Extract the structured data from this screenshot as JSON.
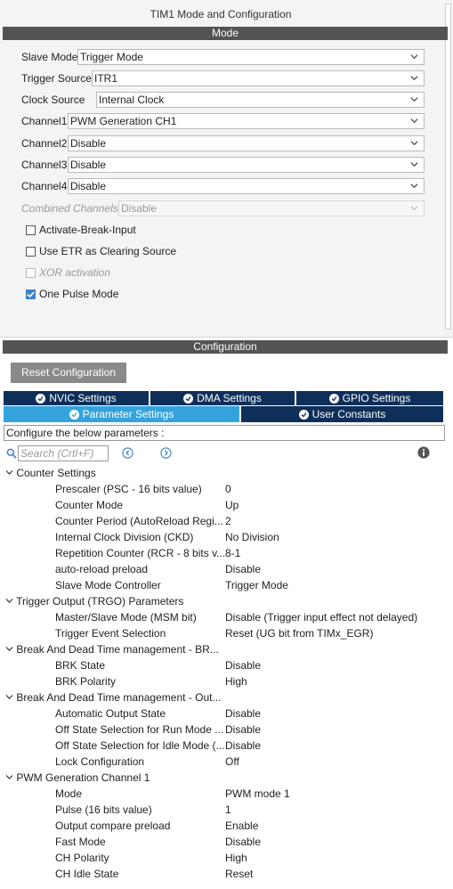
{
  "title": "TIM1 Mode and Configuration",
  "mode_section": "Mode",
  "fields": [
    {
      "label": "Slave Mode",
      "value": "Trigger Mode",
      "disabled": false
    },
    {
      "label": "Trigger Source",
      "value": "ITR1",
      "disabled": false
    },
    {
      "label": "Clock Source",
      "value": "Internal Clock",
      "disabled": false
    },
    {
      "label": "Channel1",
      "value": "PWM Generation CH1",
      "disabled": false
    },
    {
      "label": "Channel2",
      "value": "Disable",
      "disabled": false
    },
    {
      "label": "Channel3",
      "value": "Disable",
      "disabled": false
    },
    {
      "label": "Channel4",
      "value": "Disable",
      "disabled": false
    },
    {
      "label": "Combined Channels",
      "value": "Disable",
      "disabled": true
    }
  ],
  "checkboxes": [
    {
      "label": "Activate-Break-Input",
      "checked": false,
      "disabled": false
    },
    {
      "label": "Use ETR as Clearing Source",
      "checked": false,
      "disabled": false
    },
    {
      "label": "XOR activation",
      "checked": false,
      "disabled": true
    },
    {
      "label": "One Pulse Mode",
      "checked": true,
      "disabled": false
    }
  ],
  "config_section": "Configuration",
  "reset_button": "Reset Configuration",
  "tabs_row1": [
    "NVIC Settings",
    "DMA Settings",
    "GPIO Settings"
  ],
  "tabs_row2": [
    "Parameter Settings",
    "User Constants"
  ],
  "hint": "Configure the below parameters :",
  "search_placeholder": "Search (Crtl+F)",
  "groups": [
    {
      "name": "Counter Settings",
      "params": [
        {
          "name": "Prescaler (PSC - 16 bits value)",
          "value": "0"
        },
        {
          "name": "Counter Mode",
          "value": "Up"
        },
        {
          "name": "Counter Period (AutoReload Regi...",
          "value": "2"
        },
        {
          "name": "Internal Clock Division (CKD)",
          "value": "No Division"
        },
        {
          "name": "Repetition Counter (RCR - 8 bits v...",
          "value": "8-1"
        },
        {
          "name": "auto-reload preload",
          "value": "Disable"
        },
        {
          "name": "Slave Mode Controller",
          "value": "Trigger Mode"
        }
      ]
    },
    {
      "name": "Trigger Output (TRGO) Parameters",
      "params": [
        {
          "name": "Master/Slave Mode (MSM bit)",
          "value": "Disable (Trigger input effect not delayed)"
        },
        {
          "name": "Trigger Event Selection",
          "value": "Reset (UG bit from TIMx_EGR)"
        }
      ]
    },
    {
      "name": "Break And Dead Time management - BR...",
      "params": [
        {
          "name": "BRK State",
          "value": "Disable"
        },
        {
          "name": "BRK Polarity",
          "value": "High"
        }
      ]
    },
    {
      "name": "Break And Dead Time management - Out...",
      "params": [
        {
          "name": "Automatic Output State",
          "value": "Disable"
        },
        {
          "name": "Off State Selection for Run Mode ...",
          "value": "Disable"
        },
        {
          "name": "Off State Selection for Idle Mode (...",
          "value": "Disable"
        },
        {
          "name": "Lock Configuration",
          "value": "Off"
        }
      ]
    },
    {
      "name": "PWM Generation Channel 1",
      "params": [
        {
          "name": "Mode",
          "value": "PWM mode 1"
        },
        {
          "name": "Pulse (16 bits value)",
          "value": "1"
        },
        {
          "name": "Output compare preload",
          "value": "Enable"
        },
        {
          "name": "Fast Mode",
          "value": "Disable"
        },
        {
          "name": "CH Polarity",
          "value": "High"
        },
        {
          "name": "CH Idle State",
          "value": "Reset"
        }
      ]
    }
  ]
}
